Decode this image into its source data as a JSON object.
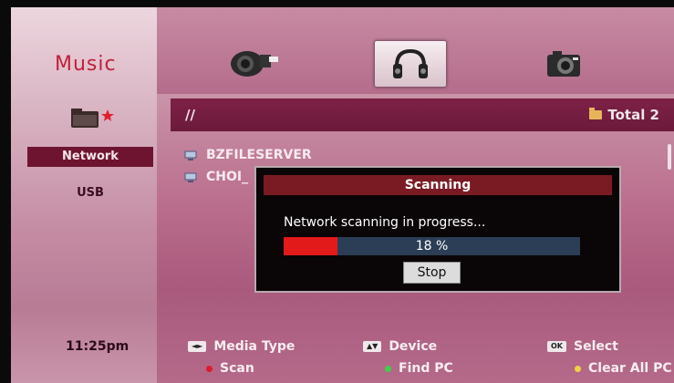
{
  "header": {
    "title": "Music"
  },
  "media_tabs": [
    {
      "name": "video-icon",
      "selected": false
    },
    {
      "name": "headphones-icon",
      "selected": true
    },
    {
      "name": "camera-icon",
      "selected": false
    }
  ],
  "path_bar": {
    "path": "//",
    "total": "Total 2"
  },
  "sources": [
    {
      "label": "Network",
      "active": true
    },
    {
      "label": "USB",
      "active": false
    }
  ],
  "files": [
    {
      "label": "BZFILESERVER"
    },
    {
      "label": "CHOI_"
    }
  ],
  "dialog": {
    "title": "Scanning",
    "message": "Network scanning in progress...",
    "progress": 18,
    "progress_label": "18 %",
    "stop_label": "Stop"
  },
  "status": {
    "time": "11:25pm"
  },
  "footer": {
    "media_type": {
      "key": "◄►",
      "label": "Media Type"
    },
    "device": {
      "key": "▲▼",
      "label": "Device"
    },
    "select": {
      "key": "OK",
      "label": "Select"
    },
    "scan": {
      "label": "Scan",
      "color": "#e01a2a"
    },
    "find_pc": {
      "label": "Find PC",
      "color": "#3fcf4a"
    },
    "clear_all": {
      "label": "Clear All PC",
      "color": "#f0d43a"
    }
  }
}
